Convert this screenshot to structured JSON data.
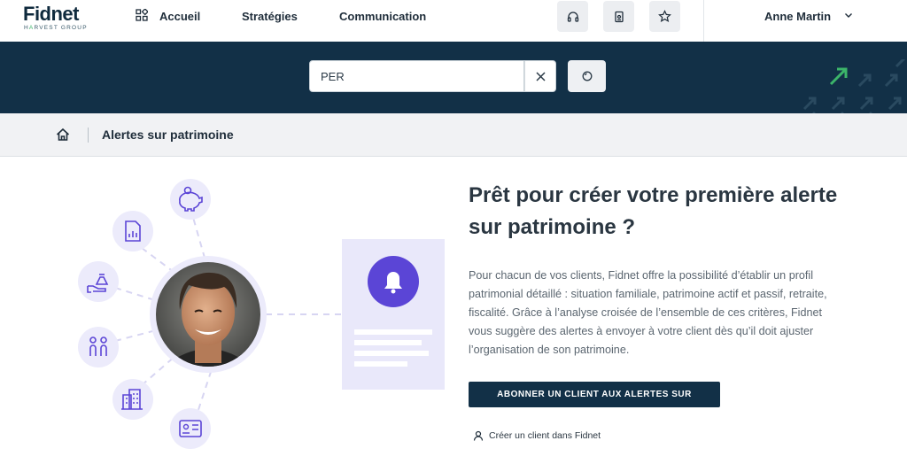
{
  "header": {
    "logo_main": "Fidnet",
    "logo_sub_prefix": "H",
    "logo_sub_accent": "A",
    "logo_sub_rest": "RVEST GROUP",
    "nav": [
      {
        "label": "Accueil",
        "icon": "grid-icon"
      },
      {
        "label": "Stratégies"
      },
      {
        "label": "Communication"
      }
    ],
    "icon_buttons": [
      "headset-icon",
      "document-icon",
      "star-icon"
    ],
    "user_name": "Anne Martin"
  },
  "search": {
    "value": "PER",
    "placeholder": ""
  },
  "breadcrumb": {
    "title": "Alertes sur patrimoine"
  },
  "content": {
    "headline": "Prêt pour créer votre première alerte sur patrimoine ?",
    "description": "Pour chacun de vos clients, Fidnet offre la possibilité d’établir un profil patrimonial détaillé : situation familiale, patrimoine actif et passif, retraite, fiscalité. Grâce à l’analyse croisée de l’ensemble de ces critères, Fidnet vous suggère des alertes à envoyer à votre client dès qu’il doit ajuster l’organisation de son patrimoine.",
    "cta_label": "ABONNER UN CLIENT AUX ALERTES SUR PATRIMOINE",
    "create_link_label": "Créer un client dans Fidnet"
  },
  "colors": {
    "navy": "#123047",
    "accent_green": "#3cb56a",
    "illus_purple": "#5b45d6",
    "illus_circle": "#ecebfb"
  }
}
